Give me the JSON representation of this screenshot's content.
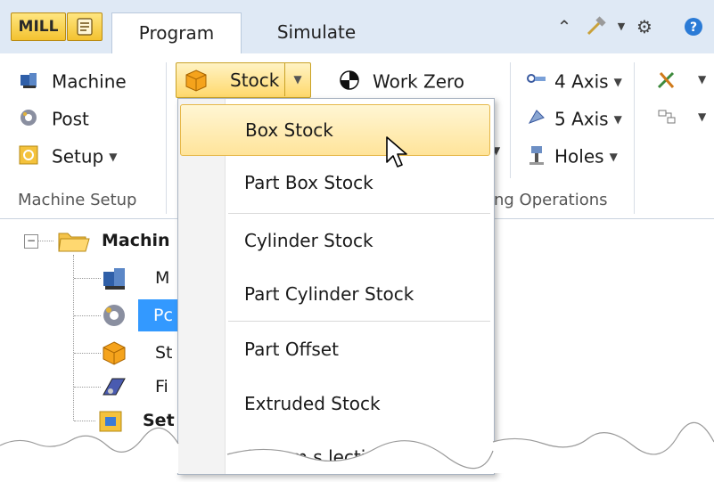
{
  "tabbar": {
    "mill_badge": "MILL",
    "tabs": [
      {
        "label": "Program",
        "active": true
      },
      {
        "label": "Simulate",
        "active": false
      }
    ]
  },
  "ribbon": {
    "groups": [
      {
        "label": "Machine Setup"
      },
      {
        "label": "ng Operations"
      }
    ],
    "machine_setup": {
      "machine_label": "Machine",
      "post_label": "Post",
      "setup_label": "Setup",
      "stock_label": "Stock"
    },
    "operations": {
      "work_zero_label": "Work Zero",
      "axis4_label": "4 Axis",
      "axis5_label": "5 Axis",
      "holes_label": "Holes"
    }
  },
  "tree": {
    "root_label": "Machin",
    "items": [
      {
        "label": "M",
        "icon": "machine-icon"
      },
      {
        "label": "Pc",
        "icon": "post-icon",
        "selected": true
      },
      {
        "label": "St",
        "icon": "stock-icon"
      },
      {
        "label": "Fi",
        "icon": "fixture-icon"
      },
      {
        "label": "Set",
        "icon": "setup-icon"
      }
    ]
  },
  "stock_menu": {
    "items": [
      {
        "label": "Box Stock",
        "highlighted": true
      },
      {
        "label": "Part Box Stock"
      },
      {
        "label": "Cylinder Stock"
      },
      {
        "label": "Part Cylinder Stock"
      },
      {
        "label": "Part Offset"
      },
      {
        "label": "Extruded Stock"
      },
      {
        "label": "Ste    am s  lection"
      }
    ]
  },
  "colors": {
    "accent_yellow": "#ffd86b",
    "selection_blue": "#3399ff",
    "tabbar_bg": "#dfe9f5"
  }
}
